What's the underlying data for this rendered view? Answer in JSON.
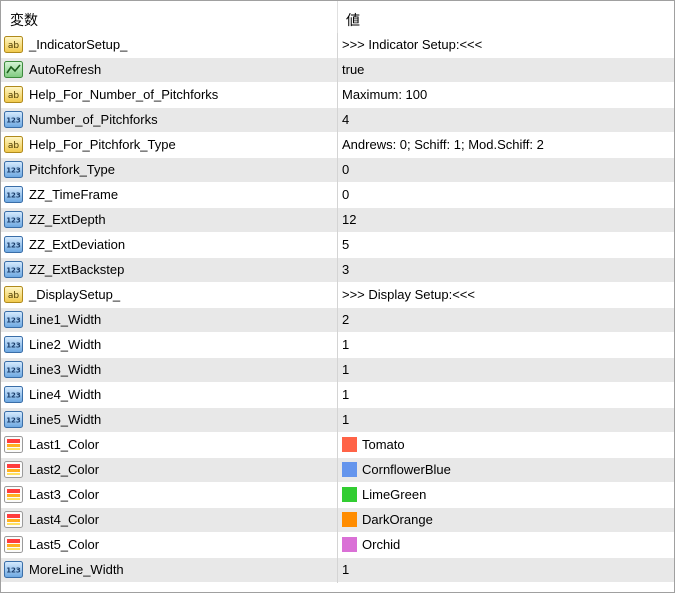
{
  "header": {
    "name_col": "変数",
    "value_col": "値"
  },
  "rows": [
    {
      "icon": "ab-text-icon",
      "name": "_IndicatorSetup_",
      "value": ">>> Indicator Setup:<<<"
    },
    {
      "icon": "bool-chart-icon",
      "name": "AutoRefresh",
      "value": "true"
    },
    {
      "icon": "ab-text-icon",
      "name": "Help_For_Number_of_Pitchforks",
      "value": "Maximum: 100"
    },
    {
      "icon": "int-123-icon",
      "name": "Number_of_Pitchforks",
      "value": "4"
    },
    {
      "icon": "ab-text-icon",
      "name": "Help_For_Pitchfork_Type",
      "value": "Andrews: 0; Schiff: 1; Mod.Schiff: 2"
    },
    {
      "icon": "int-123-icon",
      "name": "Pitchfork_Type",
      "value": "0"
    },
    {
      "icon": "int-123-icon",
      "name": "ZZ_TimeFrame",
      "value": "0"
    },
    {
      "icon": "int-123-icon",
      "name": "ZZ_ExtDepth",
      "value": "12"
    },
    {
      "icon": "int-123-icon",
      "name": "ZZ_ExtDeviation",
      "value": "5"
    },
    {
      "icon": "int-123-icon",
      "name": "ZZ_ExtBackstep",
      "value": "3"
    },
    {
      "icon": "ab-text-icon",
      "name": "_DisplaySetup_",
      "value": ">>> Display Setup:<<<"
    },
    {
      "icon": "int-123-icon",
      "name": "Line1_Width",
      "value": "2"
    },
    {
      "icon": "int-123-icon",
      "name": "Line2_Width",
      "value": "1"
    },
    {
      "icon": "int-123-icon",
      "name": "Line3_Width",
      "value": "1"
    },
    {
      "icon": "int-123-icon",
      "name": "Line4_Width",
      "value": "1"
    },
    {
      "icon": "int-123-icon",
      "name": "Line5_Width",
      "value": "1"
    },
    {
      "icon": "color-palette-icon",
      "name": "Last1_Color",
      "value": "Tomato",
      "color": "#FF6347"
    },
    {
      "icon": "color-palette-icon",
      "name": "Last2_Color",
      "value": "CornflowerBlue",
      "color": "#6495ED"
    },
    {
      "icon": "color-palette-icon",
      "name": "Last3_Color",
      "value": "LimeGreen",
      "color": "#32CD32"
    },
    {
      "icon": "color-palette-icon",
      "name": "Last4_Color",
      "value": "DarkOrange",
      "color": "#FF8C00"
    },
    {
      "icon": "color-palette-icon",
      "name": "Last5_Color",
      "value": "Orchid",
      "color": "#DA70D6"
    },
    {
      "icon": "int-123-icon",
      "name": "MoreLine_Width",
      "value": "1"
    }
  ]
}
